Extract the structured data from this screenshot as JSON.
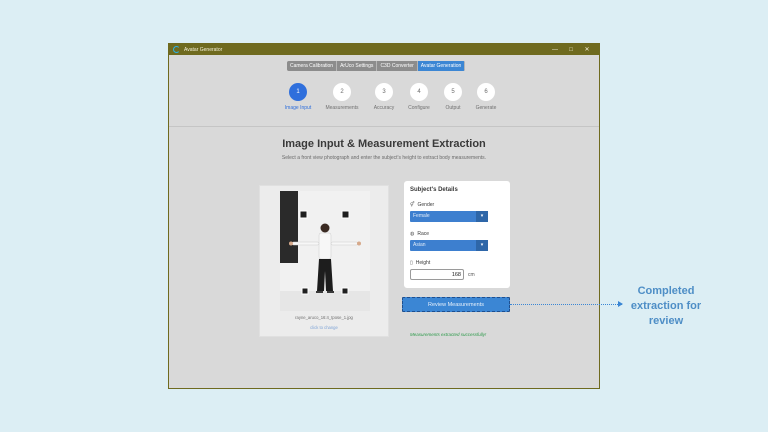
{
  "window": {
    "title": "Avatar Generator",
    "controls": [
      "—",
      "□",
      "✕"
    ]
  },
  "tabs": [
    {
      "label": "Camera Calibration",
      "active": false
    },
    {
      "label": "ArUco Settings",
      "active": false
    },
    {
      "label": "C3D Converter",
      "active": false
    },
    {
      "label": "Avatar Generation",
      "active": true
    }
  ],
  "steps": [
    {
      "number": "1",
      "label": "Image Input",
      "active": true
    },
    {
      "number": "2",
      "label": "Measurements",
      "active": false
    },
    {
      "number": "3",
      "label": "Accuracy",
      "active": false
    },
    {
      "number": "4",
      "label": "Configure",
      "active": false
    },
    {
      "number": "5",
      "label": "Output",
      "active": false
    },
    {
      "number": "6",
      "label": "Generate",
      "active": false
    }
  ],
  "page": {
    "title": "Image Input & Measurement Extraction",
    "subtitle": "Select a front view photograph and enter the subject's height to extract body measurements."
  },
  "image_card": {
    "filename": "rayne_aruco_16:4_tpose_1.jpg",
    "change_link": "click to change"
  },
  "details": {
    "header": "Subject's Details",
    "gender": {
      "label": "Gender",
      "value": "Female"
    },
    "race": {
      "label": "Race",
      "value": "Asian"
    },
    "height": {
      "label": "Height",
      "value": "168",
      "unit": "cm"
    }
  },
  "review_button": "Review Measurements",
  "success_message": "Measurements extracted successfully!",
  "callout": "Completed extraction for review",
  "icons": {
    "gender": "gender-icon",
    "race": "globe-icon",
    "height": "ruler-icon",
    "dropdown": "chevron-down-icon"
  },
  "colors": {
    "accent": "#3b86d4",
    "titlebar": "#6f6a1f",
    "success": "#2d9a4a"
  }
}
